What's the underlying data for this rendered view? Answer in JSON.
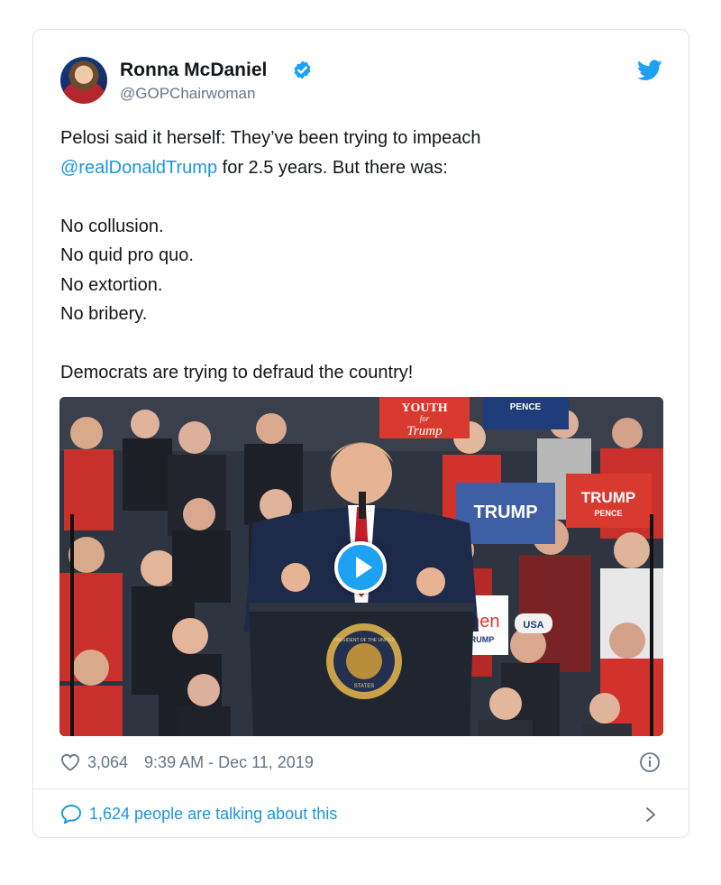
{
  "user": {
    "name": "Ronna McDaniel",
    "handle": "@GOPChairwoman",
    "verified": true
  },
  "tweet": {
    "line1": "Pelosi said it herself: They’ve been trying to impeach",
    "mention": "@realDonaldTrump",
    "line2_rest": " for 2.5 years. But there was:",
    "list": [
      "No collusion.",
      "No quid pro quo.",
      "No extortion.",
      "No bribery."
    ],
    "closing": "Democrats are trying to defraud the country!"
  },
  "media": {
    "type": "video",
    "signs": {
      "youth_top": "YOUTH",
      "youth_for": "for",
      "youth_trump": "Trump",
      "pence": "PENCE",
      "trump": "TRUMP",
      "trump_sign2": "TRUMP",
      "trump_pence_red": "TRUMP",
      "trump_pence_red_sub": "PENCE",
      "men": "men",
      "men_sub": "RUMP",
      "usa": "USA",
      "seal_top": "PRESIDENT OF THE UNITED",
      "seal_bottom": "STATES"
    }
  },
  "footer": {
    "likes": "3,064",
    "timestamp": "9:39 AM - Dec 11, 2019",
    "talking": "1,624 people are talking about this"
  },
  "colors": {
    "link": "#1b95e0",
    "muted": "#657786",
    "verified": "#1da1f2",
    "bird": "#1da1f2"
  }
}
